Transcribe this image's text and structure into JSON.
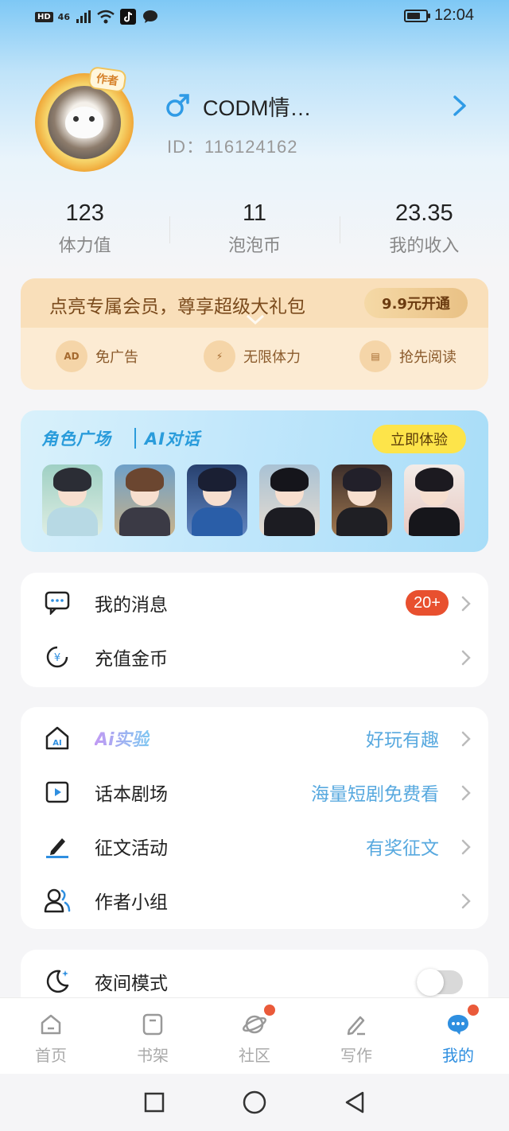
{
  "status_bar": {
    "network_badge": "HD",
    "signal_label": "46",
    "time": "12:04",
    "icons": [
      "signal-icon",
      "wifi-icon",
      "tiktok-icon",
      "chat-icon",
      "battery-icon"
    ]
  },
  "profile": {
    "avatar_badge": "作者",
    "gender_icon": "male-icon",
    "username": "CODM情…",
    "user_id": "ID：116124162"
  },
  "stats": [
    {
      "value": "123",
      "label": "体力值"
    },
    {
      "value": "11",
      "label": "泡泡币"
    },
    {
      "value": "23.35",
      "label": "我的收入"
    }
  ],
  "vip": {
    "title": "点亮专属会员，尊享超级大礼包",
    "button": "9.9元开通",
    "perks": [
      {
        "icon": "ad-icon",
        "icon_text": "AD",
        "label": "免广告"
      },
      {
        "icon": "lightning-icon",
        "icon_text": "⚡",
        "label": "无限体力"
      },
      {
        "icon": "book-icon",
        "icon_text": "▤",
        "label": "抢先阅读"
      }
    ]
  },
  "ai_banner": {
    "title_left": "角色广场",
    "title_right": "AI对话",
    "button": "立即体验",
    "colors": {
      "title": "#2a9cdb",
      "button_bg": "#fde44a"
    }
  },
  "menu_group_1": [
    {
      "icon": "message-icon",
      "label": "我的消息",
      "badge": "20+"
    },
    {
      "icon": "coin-icon",
      "label": "充值金币"
    }
  ],
  "menu_group_2": [
    {
      "icon": "ai-home-icon",
      "label": "Ai实验",
      "hint": "好玩有趣"
    },
    {
      "icon": "play-icon",
      "label": "话本剧场",
      "hint": "海量短剧免费看"
    },
    {
      "icon": "pen-icon",
      "label": "征文活动",
      "hint": "有奖征文"
    },
    {
      "icon": "group-icon",
      "label": "作者小组"
    }
  ],
  "menu_group_3": [
    {
      "icon": "moon-icon",
      "label": "夜间模式",
      "toggle_on": false
    }
  ],
  "tab_bar": [
    {
      "icon": "home-icon",
      "label": "首页",
      "active": false,
      "dot": false
    },
    {
      "icon": "bookshelf-icon",
      "label": "书架",
      "active": false,
      "dot": false
    },
    {
      "icon": "planet-icon",
      "label": "社区",
      "active": false,
      "dot": true
    },
    {
      "icon": "write-icon",
      "label": "写作",
      "active": false,
      "dot": false
    },
    {
      "icon": "mine-icon",
      "label": "我的",
      "active": true,
      "dot": true
    }
  ],
  "colors": {
    "accent": "#2f8fe0",
    "hint": "#58a9df",
    "badge": "#e8502f",
    "vip_text": "#7a4a1c"
  }
}
